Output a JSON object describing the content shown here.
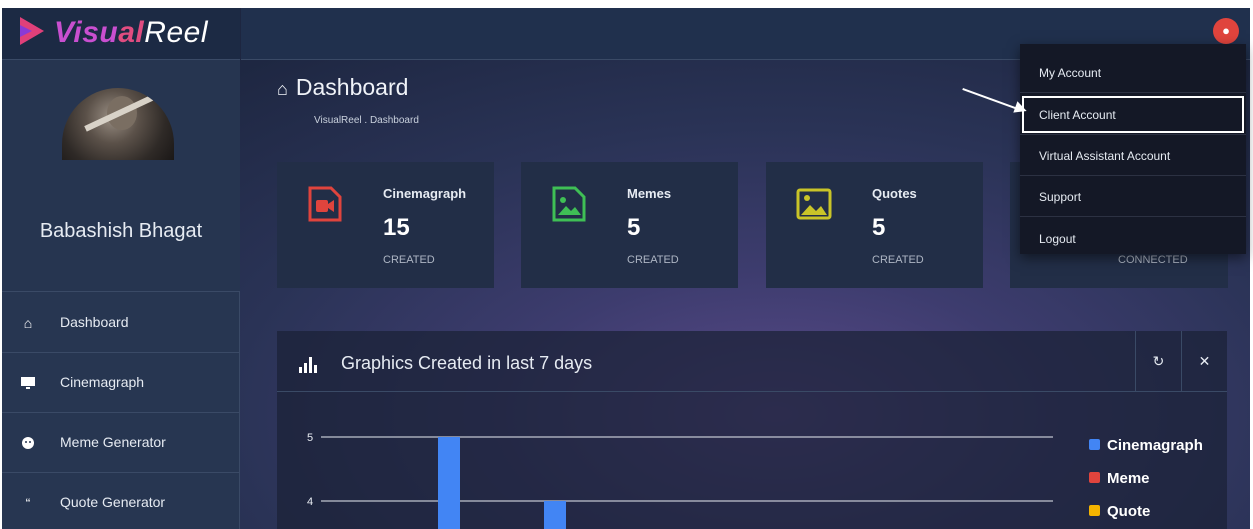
{
  "brand": {
    "part1": "Visu",
    "part2": "al",
    "part3": "Reel"
  },
  "user": {
    "name": "Babashish Bhagat"
  },
  "sidebar": {
    "items": [
      {
        "label": "Dashboard",
        "icon": "home-icon"
      },
      {
        "label": "Cinemagraph",
        "icon": "monitor-icon"
      },
      {
        "label": "Meme Generator",
        "icon": "smiley-icon"
      },
      {
        "label": "Quote Generator",
        "icon": "quote-icon"
      }
    ]
  },
  "header": {
    "title": "Dashboard",
    "breadcrumb": "VisualReel . Dashboard"
  },
  "cards": [
    {
      "title": "Cinemagraph",
      "value": "15",
      "sub": "CREATED",
      "color": "#e0443d",
      "icon": "video-file-icon"
    },
    {
      "title": "Memes",
      "value": "5",
      "sub": "CREATED",
      "color": "#3fbf55",
      "icon": "image-file-icon"
    },
    {
      "title": "Quotes",
      "value": "5",
      "sub": "CREATED",
      "color": "#c9c428",
      "icon": "picture-icon"
    },
    {
      "title": "",
      "value": "",
      "sub": "CONNECTED",
      "color": "#4a90e2",
      "icon": ""
    }
  ],
  "panel": {
    "title": "Graphics Created in last 7 days"
  },
  "chart_data": {
    "type": "bar",
    "yticks": [
      5,
      4
    ],
    "series": [
      {
        "name": "Cinemagraph",
        "color": "#4285f4",
        "values": [
          5,
          4
        ]
      },
      {
        "name": "Meme",
        "color": "#e0443d",
        "values": []
      },
      {
        "name": "Quote",
        "color": "#f4b400",
        "values": []
      }
    ],
    "legend_position": "right"
  },
  "dropdown": {
    "items": [
      {
        "label": "My Account"
      },
      {
        "label": "Client Account"
      },
      {
        "label": "Virtual Assistant Account"
      },
      {
        "label": "Support"
      },
      {
        "label": "Logout"
      }
    ]
  }
}
